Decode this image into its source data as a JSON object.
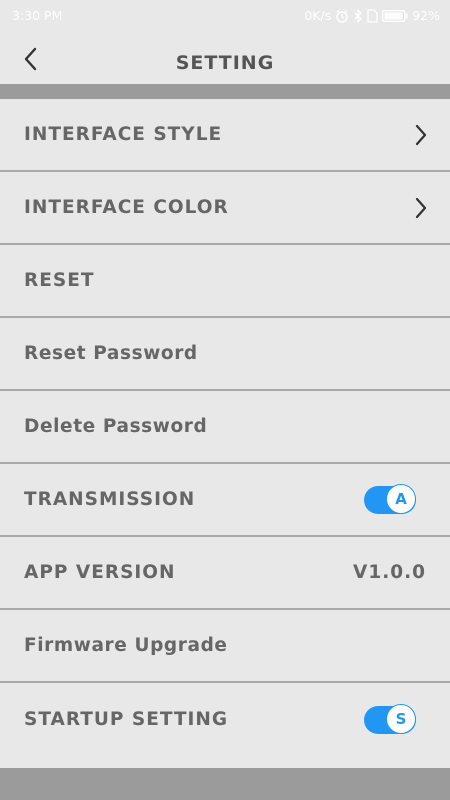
{
  "status_bar": {
    "time": "3:30 PM",
    "speed": "0K/s",
    "battery": "92%"
  },
  "header": {
    "title": "SETTING"
  },
  "settings": [
    {
      "label": "INTERFACE STYLE"
    },
    {
      "label": "INTERFACE COLOR"
    },
    {
      "label": "RESET"
    },
    {
      "label": "Reset Password"
    },
    {
      "label": "Delete Password"
    },
    {
      "label": "TRANSMISSION",
      "toggle": {
        "on": true,
        "knob": "A"
      }
    },
    {
      "label": "APP VERSION",
      "value": "V1.0.0"
    },
    {
      "label": "Firmware Upgrade"
    },
    {
      "label": "STARTUP SETTING",
      "toggle": {
        "on": true,
        "knob": "S"
      }
    }
  ],
  "colors": {
    "background": "#e8e8e8",
    "band": "#9b9b9b",
    "accent": "#2196f3",
    "text": "#666666"
  }
}
